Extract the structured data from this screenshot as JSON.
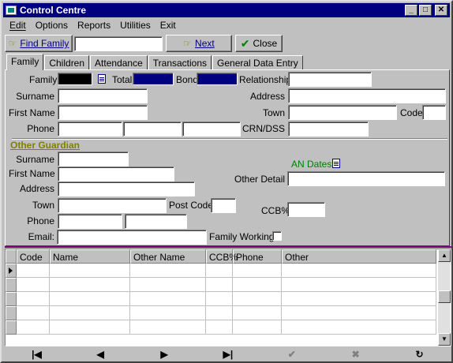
{
  "window": {
    "title": "Control Centre"
  },
  "menu": [
    "Edit",
    "Options",
    "Reports",
    "Utilities",
    "Exit"
  ],
  "toolbar": {
    "find_label": "Find Family",
    "next_label": "Next",
    "close_label": "Close",
    "find_value": ""
  },
  "tabs": [
    "Family",
    "Children",
    "Attendance",
    "Transactions",
    "General Data Entry"
  ],
  "family": {
    "family_label": "Family:",
    "total_label": "Total",
    "bond_label": "Bond",
    "relationship_label": "Relationship",
    "surname_label": "Surname",
    "firstname_label": "First Name",
    "phone_label": "Phone",
    "address_label": "Address",
    "town_label": "Town",
    "code_label": "Code",
    "crn_label": "CRN/DSS"
  },
  "other_guardian": {
    "title": "Other Guardian",
    "surname_label": "Surname",
    "firstname_label": "First Name",
    "address_label": "Address",
    "town_label": "Town",
    "postcode_label": "Post Code",
    "phone_label": "Phone",
    "email_label": "Email:",
    "an_dates_label": "AN Dates",
    "other_detail_label": "Other Detail",
    "ccb_label": "CCB%",
    "family_working_label": "Family Working:"
  },
  "grid": {
    "columns": [
      "Code",
      "Name",
      "Other Name",
      "CCB%",
      "Phone",
      "Other"
    ]
  },
  "navigator": [
    "|◀",
    "◀",
    "▶",
    "▶|",
    "✔",
    "✖",
    "↻"
  ]
}
